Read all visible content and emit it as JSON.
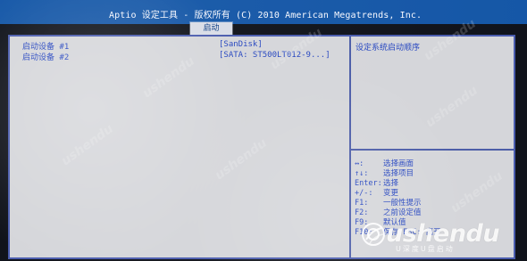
{
  "window": {
    "title": "Aptio 设定工具 - 版权所有 (C) 2010 American Megatrends, Inc.",
    "tab": "启动"
  },
  "boot_options": [
    {
      "label": "启动设备 #1",
      "value": "[SanDisk]"
    },
    {
      "label": "启动设备 #2",
      "value": "[SATA: ST500LT012-9...]"
    }
  ],
  "help": {
    "description": "设定系统启动顺序",
    "keys": [
      {
        "key": "↔:",
        "text": "选择画面"
      },
      {
        "key": "↑↓:",
        "text": "选择项目"
      },
      {
        "key": "Enter:",
        "text": "选择"
      },
      {
        "key": "+/-:",
        "text": "变更"
      },
      {
        "key": "F1:",
        "text": "一般性提示"
      },
      {
        "key": "F2:",
        "text": "之前设定值"
      },
      {
        "key": "F9:",
        "text": "默认值"
      },
      {
        "key": "F10:",
        "text": "保存 ESC: 离开"
      }
    ]
  },
  "watermarks": [
    "ushendu",
    "ushendu",
    "ushendu",
    "ushendu",
    "ushendu",
    "ushendu",
    "ushendu"
  ],
  "brand": {
    "name": "ushendu",
    "subtitle": "U深度U盘启动"
  },
  "colors": {
    "top_bar": "#1557a7",
    "panel_bg": "#d2d5da",
    "text_blue": "#2747c0",
    "border_blue": "#4a5cae"
  },
  "icons": {
    "brand_logo": "ushendu-logo-icon"
  }
}
